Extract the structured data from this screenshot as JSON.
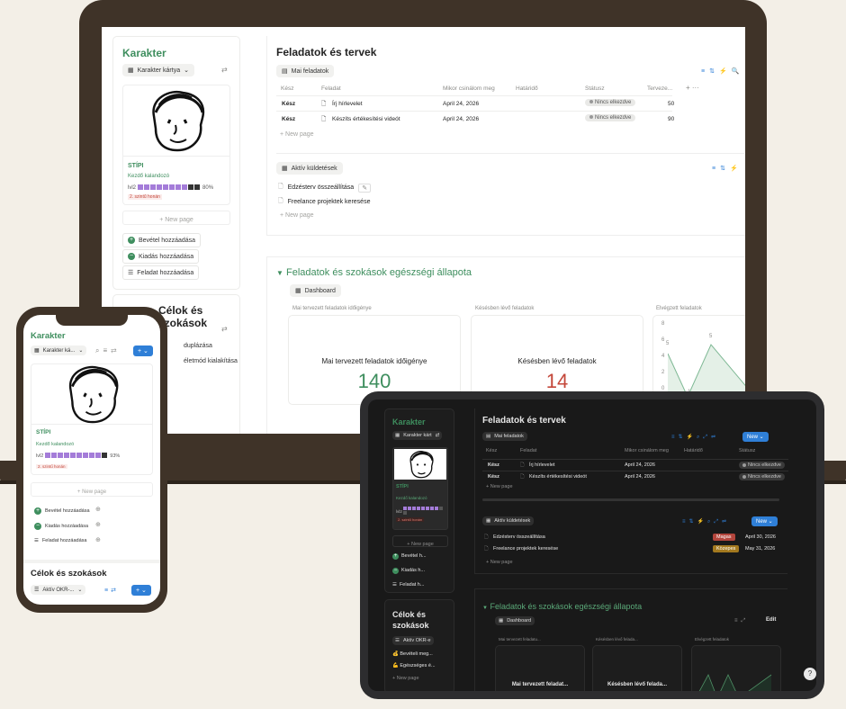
{
  "laptop": {
    "sidebar": {
      "title": "Karakter",
      "view_label": "Karakter kártya",
      "character_name": "STÍPI",
      "character_role": "Kezdő kalandozó",
      "level_label": "lvl2",
      "progress_percent": 80,
      "progress_text": "80%",
      "xp_hint": "2. szintű honán",
      "new_page": "New page",
      "actions": [
        "Bevétel hozzáadása",
        "Kiadás hozzáadása",
        "Feladat hozzáadása"
      ],
      "section2_title": "Célok és szokások",
      "section2_items": [
        "duplázása",
        "életmód kialakítása"
      ]
    },
    "tasks": {
      "title": "Feladatok és tervek",
      "view_tab": "Mai feladatok",
      "columns": [
        "Kész",
        "Feladat",
        "Mikor csinálom meg",
        "Határidő",
        "Státusz",
        "Terveze..."
      ],
      "rows": [
        {
          "done": "Kész",
          "task": "Írj hírlevelet",
          "date": "April 24, 2026",
          "deadline": "",
          "status": "Nincs elkezdve",
          "planned": "50"
        },
        {
          "done": "Kész",
          "task": "Készíts értékesítési videót",
          "date": "April 24, 2026",
          "deadline": "",
          "status": "Nincs elkezdve",
          "planned": "90"
        }
      ],
      "new_page": "New page"
    },
    "active": {
      "view_tab": "Aktív küldetések",
      "items": [
        "Edzésterv összeállítása",
        "Freelance projektek keresése"
      ],
      "new_page": "New page"
    },
    "health": {
      "title": "Feladatok és szokások egészségi állapota",
      "view_tab": "Dashboard",
      "widgets": [
        {
          "label": "Mai tervezett feladatok időigénye",
          "heading": "Mai tervezett feladatok időigénye",
          "value": "140"
        },
        {
          "label": "Késésben lévő feladatok",
          "heading": "Késésben lévő feladatok",
          "value": "14"
        },
        {
          "label": "Elvégzett feladatok"
        }
      ],
      "chart_ticks": [
        "8",
        "6",
        "4",
        "2",
        "0"
      ],
      "chart_labels": [
        "5",
        "1"
      ]
    }
  },
  "phone": {
    "title": "Karakter",
    "view_label": "Karakter ká...",
    "character_name": "STÍPI",
    "character_role": "Kezdő kalandozó",
    "level_label": "lvl2",
    "progress_text": "93%",
    "xp_hint": "2. szintű honán",
    "new_page": "New page",
    "actions": [
      "Bevétel hozzáadása",
      "Kiadás hozzáadása",
      "Feladat hozzáadása"
    ],
    "section2_title": "Célok és szokások",
    "section2_view": "Aktív OKR-..."
  },
  "tablet": {
    "sidebar": {
      "title": "Karakter",
      "view_label": "Karakter kárt",
      "character_name": "STÍPI",
      "character_role": "Kezdő kalandozó",
      "level_label": "lvl2",
      "xp_hint": "2. szintű honán",
      "new_page": "New page",
      "actions": [
        "Bevétel h...",
        "Kiadás h...",
        "Feladat h..."
      ],
      "section2_title": "Célok és szokások",
      "section2_view": "Aktív OKR-e",
      "section2_items": [
        "Bevételi meg...",
        "Egészséges é..."
      ]
    },
    "tasks": {
      "title": "Feladatok és tervek",
      "view_tab": "Mai feladatok",
      "new_label": "New",
      "columns": [
        "Kész",
        "Feladat",
        "Mikor csinálom meg",
        "Határidő",
        "Státusz"
      ],
      "rows": [
        {
          "done": "Kész",
          "task": "Írj hírlevelet",
          "date": "April 24, 2026",
          "status": "Nincs elkezdve"
        },
        {
          "done": "Kész",
          "task": "Készíts értékesítési videót",
          "date": "April 24, 2026",
          "status": "Nincs elkezdve"
        }
      ],
      "new_page": "New page"
    },
    "active": {
      "view_tab": "Aktív küldetések",
      "new_label": "New",
      "items": [
        {
          "name": "Edzésterv összeállítása",
          "tag": "Magas",
          "tag_color": "#b3453c",
          "date": "April 30, 2026"
        },
        {
          "name": "Freelance projektek keresése",
          "tag": "Közepes",
          "tag_color": "#a3791f",
          "date": "May 31, 2026"
        }
      ],
      "new_page": "New page"
    },
    "health": {
      "title": "Feladatok és szokások egészségi állapota",
      "view_tab": "Dashboard",
      "edit_label": "Edit",
      "widgets": [
        {
          "label": "Mai tervezett feladatu...",
          "heading": "Mai tervezett feladat..."
        },
        {
          "label": "Késésben lévő felada...",
          "heading": "Késésben lévő felada..."
        },
        {
          "label": "Elvégzett feladatok"
        }
      ]
    }
  },
  "colors": {
    "accent_green": "#3e8e5e",
    "accent_blue": "#2f7fd7",
    "red_value": "#c4473a",
    "progress_purple": "#a47cd9",
    "frame_brown": "#3f3328"
  }
}
